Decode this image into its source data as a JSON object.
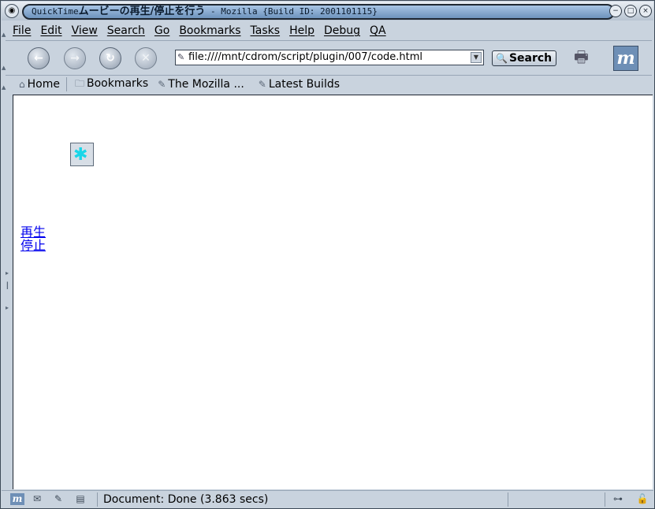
{
  "window": {
    "title_prefix": "QuickTime",
    "title_bold": "ムービーの再生/停止を行う",
    "title_suffix": " - Mozilla {Build ID: 2001101115}"
  },
  "menu": {
    "items": [
      "File",
      "Edit",
      "View",
      "Search",
      "Go",
      "Bookmarks",
      "Tasks",
      "Help",
      "Debug",
      "QA"
    ]
  },
  "navigation": {
    "url": "file:////mnt/cdrom/script/plugin/007/code.html",
    "search_label": "Search"
  },
  "personal_toolbar": {
    "items": [
      {
        "label": "Home",
        "icon": "home-icon"
      },
      {
        "label": "Bookmarks",
        "icon": "folder-icon"
      },
      {
        "label": "The Mozilla ...",
        "icon": "bookmark-icon"
      },
      {
        "label": "Latest Builds",
        "icon": "bookmark-icon"
      }
    ]
  },
  "content": {
    "links": [
      "再生",
      "停止"
    ]
  },
  "status": {
    "text": "Document: Done (3.863 secs)"
  }
}
